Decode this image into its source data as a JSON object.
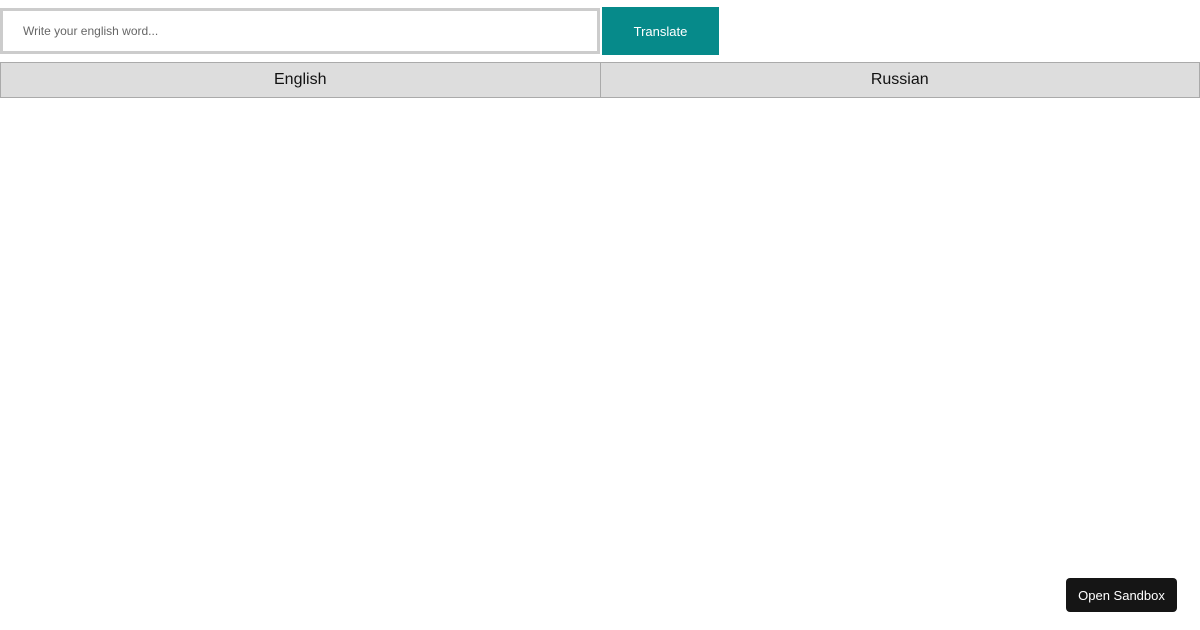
{
  "search": {
    "placeholder": "Write your english word...",
    "value": ""
  },
  "toolbar": {
    "translate_label": "Translate"
  },
  "table": {
    "columns": [
      "English",
      "Russian"
    ],
    "rows": []
  },
  "sandbox": {
    "open_label": "Open Sandbox"
  },
  "colors": {
    "accent": "#068a8a",
    "header_bg": "#dddddd",
    "sandbox_bg": "#151515"
  }
}
